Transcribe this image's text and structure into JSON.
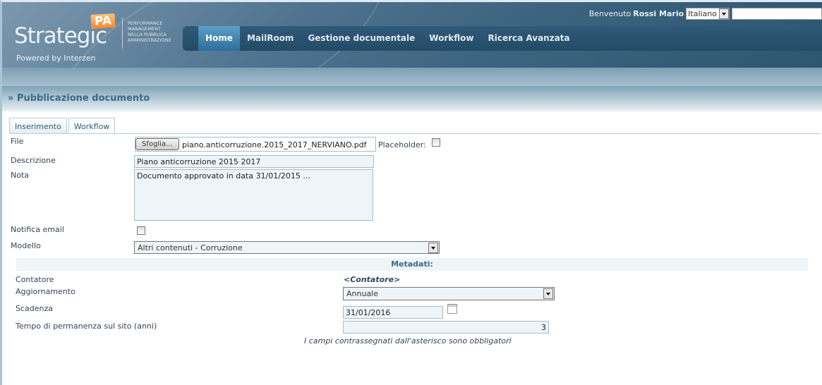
{
  "header": {
    "logo": "Strategic",
    "logo_badge": "PA",
    "tagline": [
      "PERFORMANCE",
      "MANAGEMENT",
      "NELLA PUBBLICA",
      "AMMINISTRAZIONE"
    ],
    "powered": "Powered by Interzen",
    "welcome": "Benvenuto",
    "user": "Rossi Mario",
    "language": "Italiano",
    "search_value": ""
  },
  "nav": [
    {
      "label": "Home",
      "active": true
    },
    {
      "label": "MailRoom"
    },
    {
      "label": "Gestione documentale"
    },
    {
      "label": "Workflow"
    },
    {
      "label": "Ricerca Avanzata"
    }
  ],
  "page_title": "» Pubblicazione documento",
  "tabs": [
    "Inserimento",
    "Workflow"
  ],
  "form": {
    "file_label": "File",
    "browse": "Sfoglia...",
    "file_value": "piano.anticorruzione.2015_2017_NERVIANO.pdf",
    "placeholder_label": "Placeholder:",
    "placeholder_checked": false,
    "descrizione_label": "Descrizione",
    "descrizione": "Piano anticorruzione 2015 2017",
    "nota_label": "Nota",
    "nota": "Documento approvato in data 31/01/2015 ...",
    "notifica_label": "Notifica email",
    "notifica_checked": false,
    "modello_label": "Modello",
    "modello": "Altri contenuti - Corruzione"
  },
  "metadati": {
    "title": "Metadati:",
    "contatore_label": "Contatore",
    "contatore": "<Contatore>",
    "aggiornamento_label": "Aggiornamento",
    "aggiornamento": "Annuale",
    "scadenza_label": "Scadenza",
    "scadenza": "31/01/2016",
    "tempo_label": "Tempo di permanenza sul sito (anni)",
    "tempo": "3",
    "note": "I campi contrassegnati dall'asterisco sono obbligatori"
  }
}
